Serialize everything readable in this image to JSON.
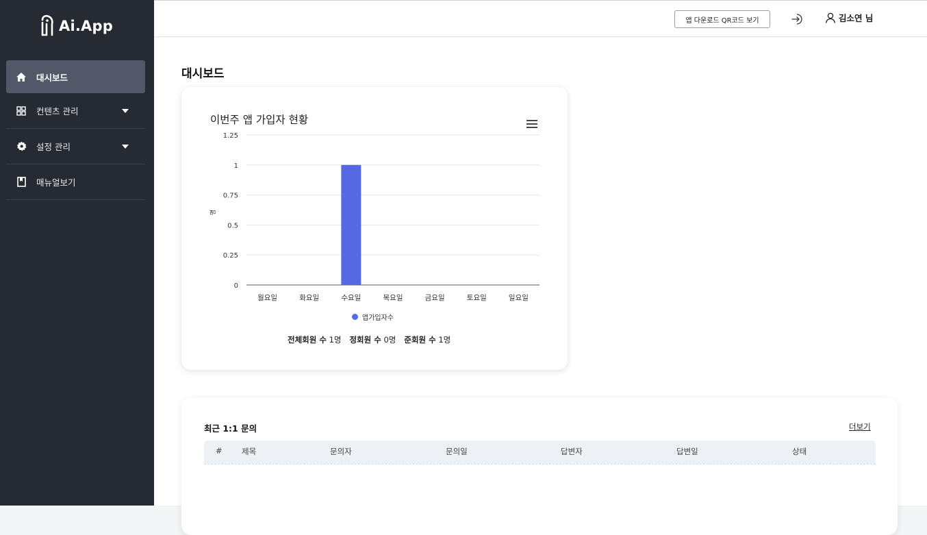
{
  "app": {
    "name": "Ai.App"
  },
  "sidebar": {
    "items": [
      {
        "label": "대시보드",
        "icon": "home-icon",
        "active": true
      },
      {
        "label": "컨텐츠 관리",
        "icon": "grid-icon",
        "expandable": true
      },
      {
        "label": "설정 관리",
        "icon": "gear-icon",
        "expandable": true
      },
      {
        "label": "매뉴얼보기",
        "icon": "bookmark-icon"
      }
    ]
  },
  "header": {
    "qr_button": "앱 다운로드 QR코드 보기",
    "user_name": "김소연 님"
  },
  "page": {
    "title": "대시보드"
  },
  "chart_card": {
    "title": "이번주 앱 가입자 현황",
    "legend": "앱가입자수",
    "stats": {
      "total_label": "전체회원 수",
      "total_value": "1명",
      "regular_label": "정회원 수",
      "regular_value": "0명",
      "associate_label": "준회원 수",
      "associate_value": "1명"
    }
  },
  "chart_data": {
    "type": "bar",
    "title": "이번주 앱 가입자 현황",
    "categories": [
      "월요일",
      "화요일",
      "수요일",
      "목요일",
      "금요일",
      "토요일",
      "일요일"
    ],
    "series": [
      {
        "name": "앱가입자수",
        "values": [
          0,
          0,
          1,
          0,
          0,
          0,
          0
        ],
        "color": "#5668e2"
      }
    ],
    "ylabel": "명",
    "ylim": [
      0,
      1.25
    ],
    "yticks": [
      "0",
      "0.25",
      "0.5",
      "0.75",
      "1",
      "1.25"
    ],
    "grid": true,
    "legend_position": "bottom"
  },
  "inquiry_table": {
    "title": "최근 1:1 문의",
    "more_link": "더보기",
    "columns": [
      "#",
      "제목",
      "문의자",
      "문의일",
      "답변자",
      "답변일",
      "상태"
    ],
    "rows": []
  },
  "colors": {
    "sidebar_bg": "#262a33",
    "active_item_bg": "#535868",
    "bar": "#5668e2"
  }
}
